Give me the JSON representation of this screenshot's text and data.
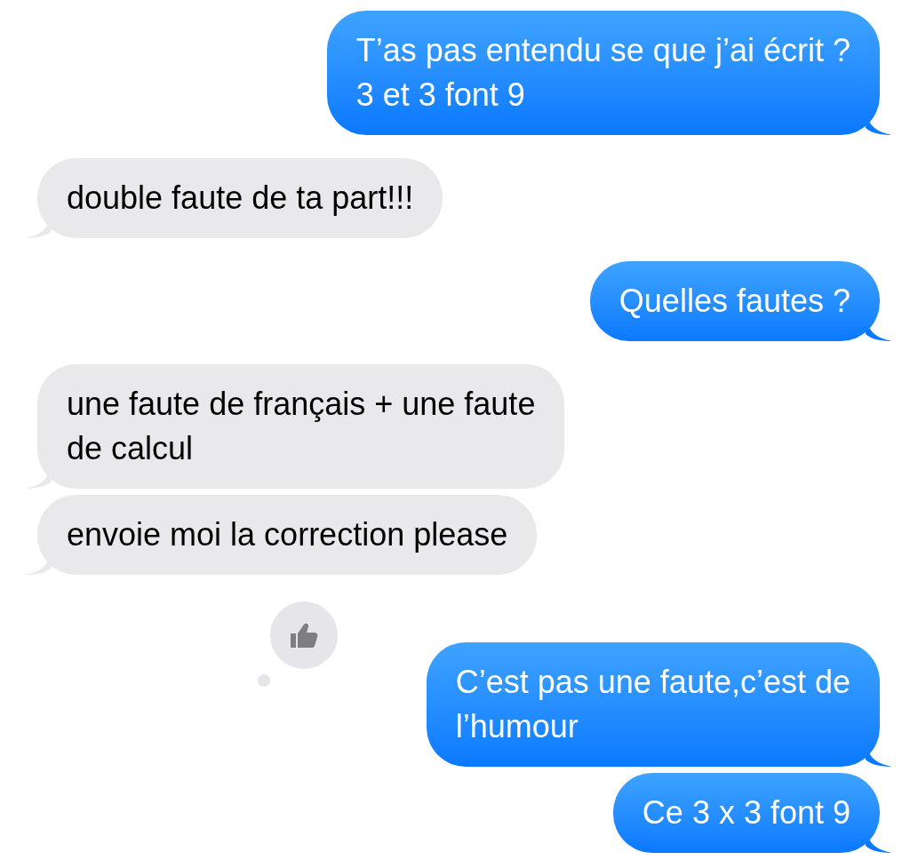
{
  "messages": [
    {
      "kind": "sent",
      "text": "T’as pas entendu se que j’ai écrit ?\n3 et 3 font 9"
    },
    {
      "kind": "received",
      "text": "double faute de ta part!!!"
    },
    {
      "kind": "sent",
      "text": "Quelles fautes ?"
    },
    {
      "kind": "received",
      "text": "une faute de français + une faute\nde calcul"
    },
    {
      "kind": "received",
      "text": "envoie moi la correction please"
    },
    {
      "kind": "sent",
      "text": "C’est pas une faute,c’est de\nl’humour",
      "reaction": {
        "kind": "thumbs_up"
      }
    },
    {
      "kind": "sent",
      "text": "Ce 3 x 3 font 9"
    }
  ]
}
